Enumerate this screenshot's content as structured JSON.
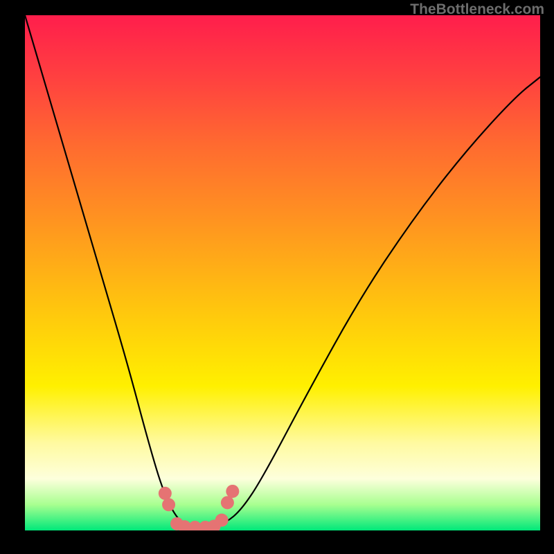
{
  "watermark": "TheBottleneck.com",
  "chart_data": {
    "type": "line",
    "title": "",
    "xlabel": "",
    "ylabel": "",
    "xlim": [
      0,
      100
    ],
    "ylim": [
      0,
      100
    ],
    "grid": false,
    "curve_description": "V-shaped bottleneck curve with minimum near x≈33, descending steeply from top-left, flat minimum region, rising toward upper-right",
    "series": [
      {
        "name": "bottleneck-curve",
        "x": [
          0,
          5,
          10,
          15,
          20,
          24,
          27,
          30,
          33,
          36,
          39,
          42,
          46,
          55,
          65,
          75,
          85,
          95,
          100
        ],
        "y": [
          100,
          83,
          66,
          49,
          32,
          17,
          7,
          1.5,
          0.5,
          0.5,
          1.5,
          4,
          10,
          27,
          45,
          60,
          73,
          84,
          88
        ]
      }
    ],
    "marker_points": {
      "description": "Pink circular markers along curve near the minimum",
      "color": "#e57373",
      "x": [
        27.2,
        27.9,
        29.5,
        31,
        33,
        35,
        36.7,
        38.2,
        39.3,
        40.3
      ],
      "y": [
        7.2,
        5,
        1.3,
        0.7,
        0.6,
        0.6,
        0.8,
        2,
        5.4,
        7.6
      ]
    },
    "gradient_colors": {
      "top": "#ff1e4c",
      "mid_upper": "#ff9420",
      "mid": "#fff000",
      "mid_lower": "#fdffdc",
      "bottom": "#00e87a"
    }
  }
}
